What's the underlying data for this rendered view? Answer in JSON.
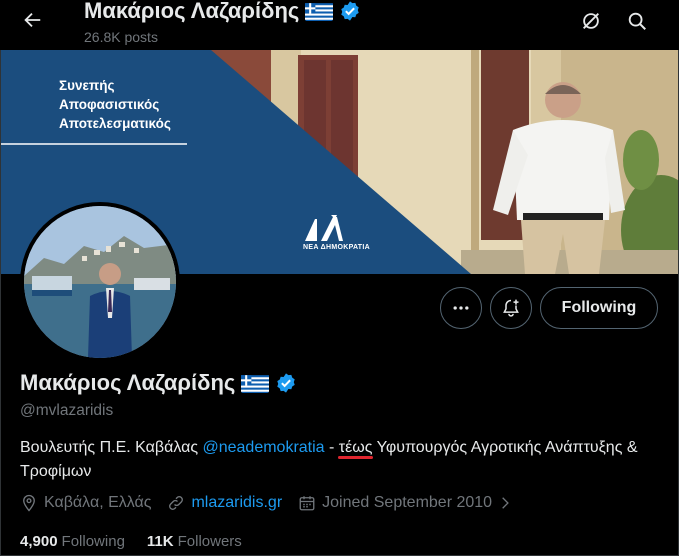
{
  "header": {
    "name": "Μακάριος Λαζαρίδης",
    "posts": "26.8K posts"
  },
  "banner": {
    "slogan": [
      "Συνεπής",
      "Αποφασιστικός",
      "Αποτελεσματικός"
    ],
    "party_mark": "ΝΔ",
    "party_label": "ΝΕΑ ΔΗΜΟΚΡΑΤΙΑ"
  },
  "actions": {
    "following_label": "Following"
  },
  "profile": {
    "name": "Μακάριος Λαζαρίδης",
    "handle": "@mvlazaridis",
    "bio_part1": "Βουλευτής Π.Ε. Καβάλας ",
    "bio_mention": "@neademokratia",
    "bio_part2": " - ",
    "bio_underlined": "τέως",
    "bio_part3": " Υφυπουργός Αγροτικής Ανάπτυξης & Τροφίμων",
    "location": "Καβάλα, Ελλάς",
    "website": "mlazaridis.gr",
    "joined": "Joined September 2010",
    "following_count": "4,900",
    "following_label": "Following",
    "followers_count": "11K",
    "followers_label": "Followers"
  },
  "colors": {
    "accent": "#1d9bf0",
    "party_blue": "#1b4d7e",
    "underline": "#e0262f"
  }
}
